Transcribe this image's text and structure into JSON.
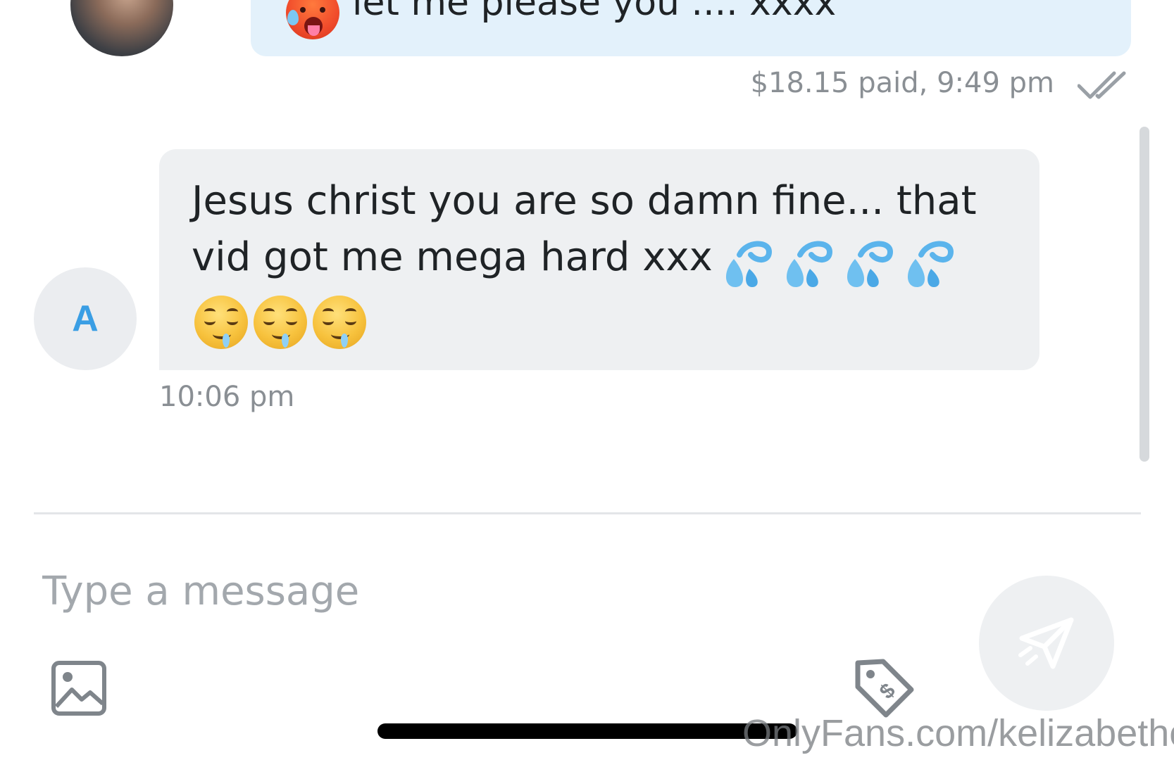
{
  "conversation": {
    "outgoing_message": {
      "text": "let me please you .... xxxx",
      "payment_status": "$18.15 paid,",
      "time": "9:49 pm",
      "status_icon": "double-check-icon",
      "emoji": "hot-face-emoji"
    },
    "incoming_message": {
      "avatar_initial": "A",
      "text": "Jesus christ you are so damn fine... that vid got me mega hard xxx",
      "emojis_inline": [
        "sweat-droplets-emoji",
        "sweat-droplets-emoji",
        "sweat-droplets-emoji",
        "sweat-droplets-emoji"
      ],
      "emojis_row": [
        "drooling-face-emoji",
        "drooling-face-emoji",
        "drooling-face-emoji"
      ],
      "time": "10:06 pm"
    }
  },
  "composer": {
    "placeholder": "Type a message",
    "value": "",
    "image_icon": "image-icon",
    "price_icon": "price-tag-icon",
    "send_icon": "send-icon"
  },
  "watermark": "OnlyFans.com/kelizabethc",
  "colors": {
    "accent": "#3a9ee4",
    "outgoing_bubble": "#e3f1fb",
    "incoming_bubble": "#eef0f2",
    "meta_text": "#8a8f94"
  }
}
